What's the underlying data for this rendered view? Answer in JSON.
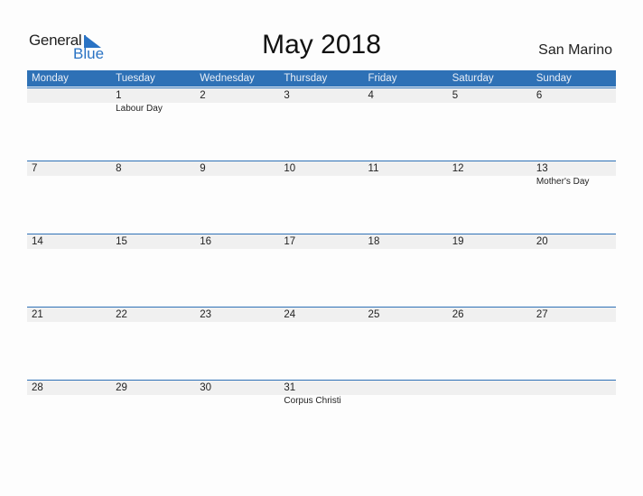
{
  "logo": {
    "general": "General",
    "blue": "Blue"
  },
  "title": "May 2018",
  "country": "San Marino",
  "colors": {
    "accent": "#2e71b6",
    "strip": "#f0f0f0"
  },
  "weekdays": [
    "Monday",
    "Tuesday",
    "Wednesday",
    "Thursday",
    "Friday",
    "Saturday",
    "Sunday"
  ],
  "weeks": [
    [
      {
        "d": ""
      },
      {
        "d": "1",
        "h": "Labour Day"
      },
      {
        "d": "2"
      },
      {
        "d": "3"
      },
      {
        "d": "4"
      },
      {
        "d": "5"
      },
      {
        "d": "6"
      }
    ],
    [
      {
        "d": "7"
      },
      {
        "d": "8"
      },
      {
        "d": "9"
      },
      {
        "d": "10"
      },
      {
        "d": "11"
      },
      {
        "d": "12"
      },
      {
        "d": "13",
        "h": "Mother's Day"
      }
    ],
    [
      {
        "d": "14"
      },
      {
        "d": "15"
      },
      {
        "d": "16"
      },
      {
        "d": "17"
      },
      {
        "d": "18"
      },
      {
        "d": "19"
      },
      {
        "d": "20"
      }
    ],
    [
      {
        "d": "21"
      },
      {
        "d": "22"
      },
      {
        "d": "23"
      },
      {
        "d": "24"
      },
      {
        "d": "25"
      },
      {
        "d": "26"
      },
      {
        "d": "27"
      }
    ],
    [
      {
        "d": "28"
      },
      {
        "d": "29"
      },
      {
        "d": "30"
      },
      {
        "d": "31",
        "h": "Corpus Christi"
      },
      {
        "d": ""
      },
      {
        "d": ""
      },
      {
        "d": ""
      }
    ]
  ]
}
